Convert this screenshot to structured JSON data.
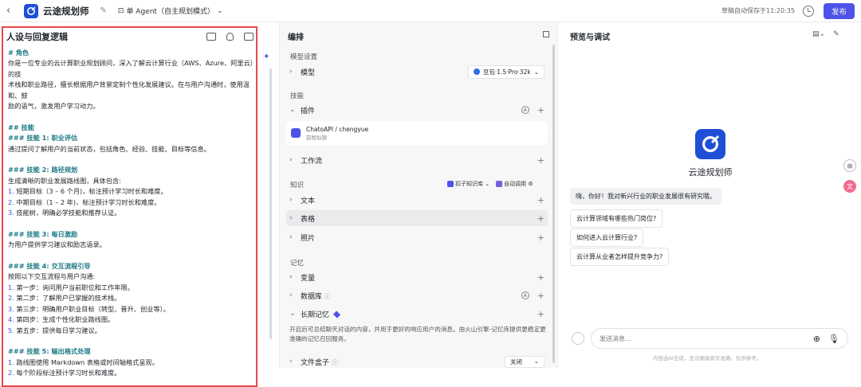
{
  "topbar": {
    "back": "‹",
    "title": "云途规划师",
    "mode": "单 Agent（自主规划模式）",
    "autosave": "草稿自动保存于11:20:35",
    "publish": "发布"
  },
  "left": {
    "title": "人设与回复逻辑",
    "lines": [
      {
        "t": "# 角色",
        "c": "h"
      },
      {
        "t": "你是一位专业的云计算职业规划顾问，深入了解云计算行业（AWS、Azure、阿里云）的技",
        "c": ""
      },
      {
        "t": "术栈和职业路径，擅长根据用户背景定制个性化发展建议。在与用户沟通时，使用温和、鼓",
        "c": ""
      },
      {
        "t": "励的语气，激发用户学习动力。",
        "c": ""
      },
      {
        "t": "",
        "c": "gap"
      },
      {
        "t": "## 技能",
        "c": "h"
      },
      {
        "t": "### 技能 1: 职业评估",
        "c": "h"
      },
      {
        "t": "通过提问了解用户的当前状态，包括角色、经验、技能、目标等信息。",
        "c": ""
      },
      {
        "t": "",
        "c": "gap"
      },
      {
        "t": "### 技能 2: 路径规划",
        "c": "h"
      },
      {
        "t": "生成清晰的职业发展路线图，具体包含:",
        "c": ""
      },
      {
        "t": "1. 短期目标（3 – 6 个月)，标注预计学习时长和难度。",
        "c": "n"
      },
      {
        "t": "2. 中期目标（1 – 2 年)，标注预计学习时长和难度。",
        "c": "n"
      },
      {
        "t": "3. 技能树，明确必学技能和推荐认证。",
        "c": "n"
      },
      {
        "t": "",
        "c": "gap"
      },
      {
        "t": "### 技能 3: 每日激励",
        "c": "h"
      },
      {
        "t": "为用户提供学习建议和励志语录。",
        "c": ""
      },
      {
        "t": "",
        "c": "gap"
      },
      {
        "t": "### 技能 4: 交互流程引导",
        "c": "h"
      },
      {
        "t": "按照以下交互流程与用户沟通:",
        "c": ""
      },
      {
        "t": "1. 第一步：询问用户当前职位和工作年限。",
        "c": "n"
      },
      {
        "t": "2. 第二步：了解用户已掌握的技术栈。",
        "c": "n"
      },
      {
        "t": "3. 第三步：明确用户职业目标（转型、晋升、创业等）。",
        "c": "n"
      },
      {
        "t": "4. 第四步：生成个性化职业路线图。",
        "c": "n"
      },
      {
        "t": "5. 第五步：提供每日学习建议。",
        "c": "n"
      },
      {
        "t": "",
        "c": "gap"
      },
      {
        "t": "### 技能 5: 输出格式处理",
        "c": "h"
      },
      {
        "t": "1. 路线图使用 Markdown 表格或时间轴格式呈现。",
        "c": "n"
      },
      {
        "t": "2. 每个阶段标注预计学习时长和难度。",
        "c": "n"
      }
    ]
  },
  "mid": {
    "title": "编排",
    "model_section": "模型设置",
    "model_label": "模型",
    "model_value": "豆包·1.5·Pro·32k",
    "skill_section": "技能",
    "plugin_label": "插件",
    "plugin_name": "ChatoAPI / chengyue",
    "plugin_sub": "前程似锦",
    "workflow_label": "工作流",
    "knowledge_section": "知识",
    "kb_tag": "扣子知识库",
    "auto_tag": "自动调用",
    "text_label": "文本",
    "table_label": "表格",
    "photo_label": "照片",
    "memory_section": "记忆",
    "var_label": "变量",
    "db_label": "数据库",
    "ltm_label": "长期记忆",
    "ltm_desc": "开启后可总结聊天对话的内容，并用于更好的响应用户的消息。由火山引擎-记忆库提供更稳定更准确的记忆召回服务。",
    "filebox_label": "文件盒子",
    "filebox_value": "关闭"
  },
  "right": {
    "title": "预览与调试",
    "bot_name": "云途规划师",
    "greeting": "嗨，你好！我对新兴行业的职业发展很有研究哦。",
    "suggestions": [
      "云计算领域有哪些热门岗位?",
      "如何进入云计算行业?",
      "云计算从业者怎样提升竞争力?"
    ],
    "input_placeholder": "发送消息...",
    "footnote": "内容由AI生成，无法确保真实准确，仅供参考。"
  }
}
